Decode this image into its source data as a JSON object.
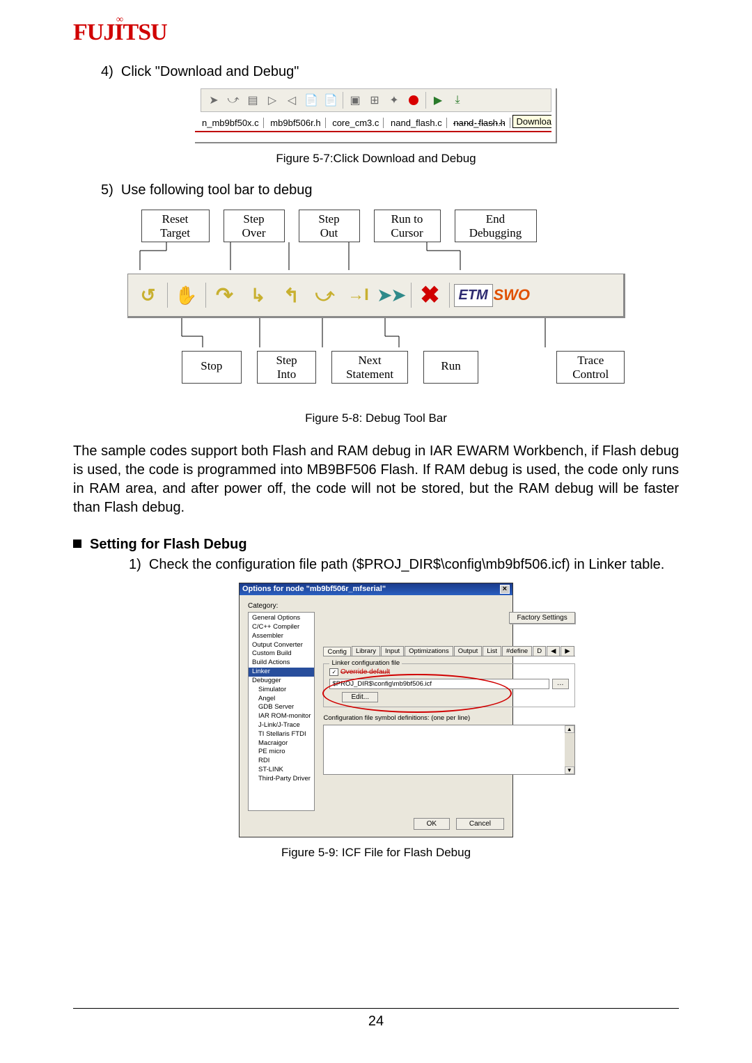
{
  "logo_text": "FUJITSU",
  "step4": {
    "num": "4)",
    "text": "Click \"Download and Debug\""
  },
  "fig57": {
    "tabs": [
      "n_mb9bf50x.c",
      "mb9bf506r.h",
      "core_cm3.c",
      "nand_flash.c",
      "nand_flash.h"
    ],
    "tooltip": "Download and Debug",
    "caption": "Figure 5-7:Click Download and Debug"
  },
  "step5": {
    "num": "5)",
    "text": "Use following tool bar to debug"
  },
  "fig58": {
    "top": [
      "Reset\nTarget",
      "Step\nOver",
      "Step\nOut",
      "Run to\nCursor",
      "End\nDebugging"
    ],
    "bottom": [
      "Stop",
      "Step\nInto",
      "Next\nStatement",
      "Run",
      "Trace\nControl"
    ],
    "etm": "ETM",
    "swo": "SWO",
    "caption": "Figure 5-8: Debug Tool Bar"
  },
  "body_para": "The sample codes support both Flash and RAM debug in IAR EWARM Workbench, if Flash debug is used, the code is programmed into MB9BF506 Flash. If RAM debug is used, the code only runs in RAM area, and after power off, the code will not be stored, but the RAM debug will be faster than Flash debug.",
  "heading": "Setting for Flash Debug",
  "step1": {
    "num": "1)",
    "text": "Check the configuration file path ($PROJ_DIR$\\config\\mb9bf506.icf) in Linker table."
  },
  "fig59": {
    "title": "Options for node \"mb9bf506r_mfserial\"",
    "category_label": "Category:",
    "factory": "Factory Settings",
    "categories": [
      "General Options",
      "C/C++ Compiler",
      "Assembler",
      "Output Converter",
      "Custom Build",
      "Build Actions",
      "Linker",
      "Debugger",
      "Simulator",
      "Angel",
      "GDB Server",
      "IAR ROM-monitor",
      "J-Link/J-Trace",
      "TI Stellaris FTDI",
      "Macraigor",
      "PE micro",
      "RDI",
      "ST-LINK",
      "Third-Party Driver"
    ],
    "tabs": [
      "Config",
      "Library",
      "Input",
      "Optimizations",
      "Output",
      "List",
      "#define",
      "D"
    ],
    "group_legend": "Linker configuration file",
    "override": "Override default",
    "path": "$PROJ_DIR$\\config\\mb9bf506.icf",
    "edit": "Edit...",
    "symdefs": "Configuration file symbol definitions: (one per line)",
    "ok": "OK",
    "cancel": "Cancel",
    "caption": "Figure 5-9:  ICF File for Flash Debug"
  },
  "page_number": "24"
}
